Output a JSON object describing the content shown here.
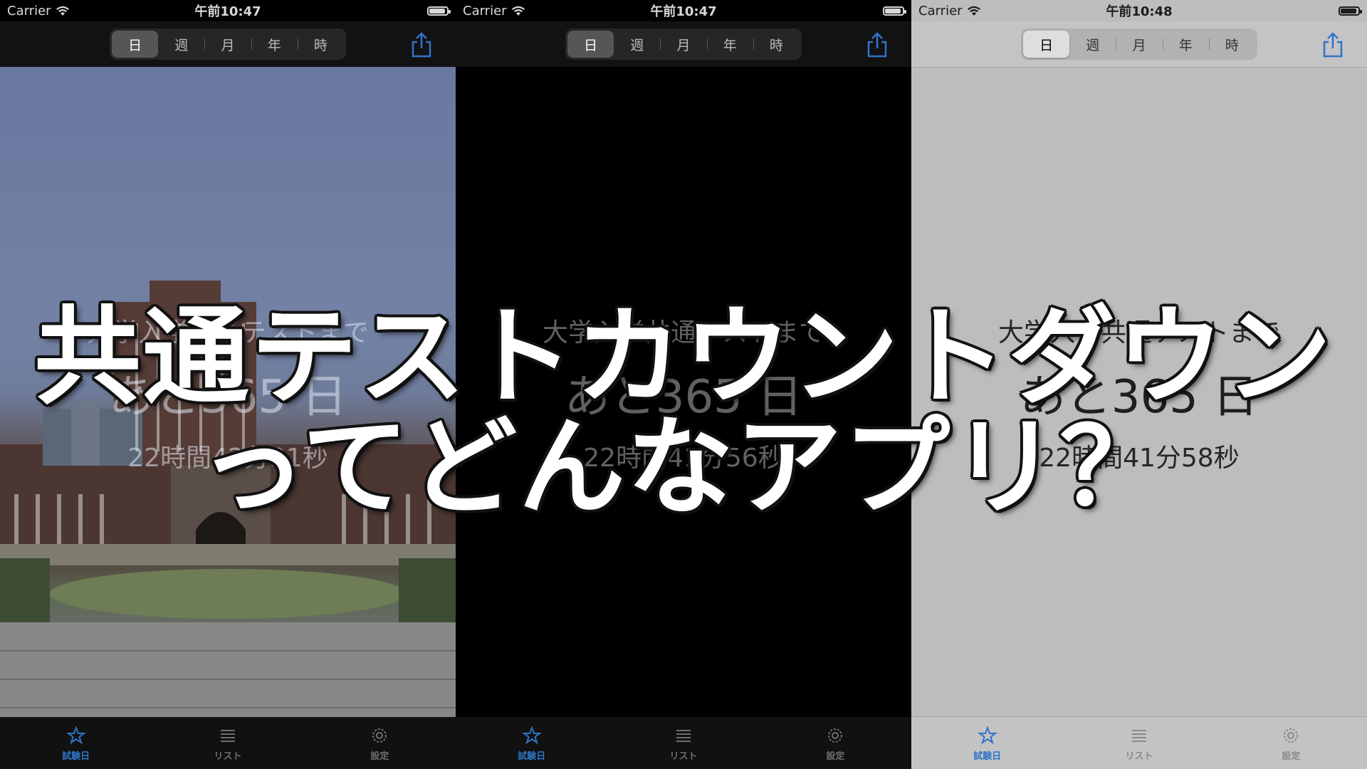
{
  "screens": [
    {
      "theme": "photo",
      "status": {
        "carrier": "Carrier",
        "time": "午前10:47"
      },
      "segments": [
        "日",
        "週",
        "月",
        "年",
        "時"
      ],
      "selected_segment": "日",
      "countdown": {
        "label": "大学入学共通テストまで",
        "days": "あと365 日",
        "remaining": "22時間42分21秒"
      },
      "tabs": [
        "試験日",
        "リスト",
        "設定"
      ]
    },
    {
      "theme": "dark",
      "status": {
        "carrier": "Carrier",
        "time": "午前10:47"
      },
      "segments": [
        "日",
        "週",
        "月",
        "年",
        "時"
      ],
      "selected_segment": "日",
      "countdown": {
        "label": "大学入学共通テストまで",
        "days": "あと365 日",
        "remaining": "22時間41分56秒"
      },
      "tabs": [
        "試験日",
        "リスト",
        "設定"
      ]
    },
    {
      "theme": "light",
      "status": {
        "carrier": "Carrier",
        "time": "午前10:48"
      },
      "segments": [
        "日",
        "週",
        "月",
        "年",
        "時"
      ],
      "selected_segment": "日",
      "countdown": {
        "label": "大学入学共通テストまで",
        "days": "あと365 日",
        "remaining": "22時間41分58秒"
      },
      "tabs": [
        "試験日",
        "リスト",
        "設定"
      ]
    }
  ],
  "overlay": {
    "line1": "共通テストカウントダウン",
    "line2": "ってどんなアプリ？"
  },
  "colors": {
    "accent": "#2f74c8",
    "overlay_text": "#ffffff",
    "overlay_outline": "#111111"
  },
  "icons": {
    "share": "share-icon",
    "tab_star": "star-icon",
    "tab_list": "list-icon",
    "tab_settings": "gear-icon",
    "wifi": "wifi-icon",
    "battery": "battery-icon"
  }
}
